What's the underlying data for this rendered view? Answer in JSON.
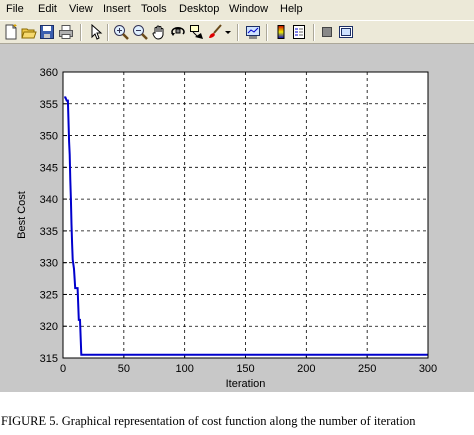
{
  "menubar": {
    "items": [
      {
        "label": "File"
      },
      {
        "label": "Edit"
      },
      {
        "label": "View"
      },
      {
        "label": "Insert"
      },
      {
        "label": "Tools"
      },
      {
        "label": "Desktop"
      },
      {
        "label": "Window"
      },
      {
        "label": "Help"
      }
    ]
  },
  "toolbar": {
    "icons": [
      "new-figure-icon",
      "open-file-icon",
      "save-icon",
      "print-icon",
      "edit-plot-pointer-icon",
      "zoom-in-icon",
      "zoom-out-icon",
      "pan-hand-icon",
      "rotate-3d-icon",
      "data-cursor-icon",
      "brush-icon",
      "brush-dropdown-icon",
      "link-plot-icon",
      "insert-colorbar-icon",
      "insert-legend-icon",
      "hide-plot-tools-icon",
      "show-plot-tools-icon"
    ]
  },
  "colors": {
    "line": "#0000cc",
    "axes_background": "#ffffff",
    "figure_background": "#c8c8c8"
  },
  "chart_data": {
    "type": "line",
    "title": "",
    "xlabel": "Iteration",
    "ylabel": "Best Cost",
    "xlim": [
      0,
      300
    ],
    "ylim": [
      315,
      360
    ],
    "x_ticks": [
      0,
      50,
      100,
      150,
      200,
      250,
      300
    ],
    "y_ticks": [
      315,
      320,
      325,
      330,
      335,
      340,
      345,
      350,
      355,
      360
    ],
    "grid": true,
    "series": [
      {
        "x": [
          1,
          2,
          3,
          4,
          5,
          5.5,
          6,
          6.5,
          7,
          7.5,
          8,
          9,
          10,
          11,
          12,
          13,
          14,
          15,
          300
        ],
        "y": [
          356,
          356,
          355.5,
          355.5,
          349,
          347,
          343,
          340,
          336,
          333,
          330.5,
          329,
          326,
          326,
          326,
          321,
          321,
          315.5,
          315.5
        ]
      }
    ]
  },
  "caption": "FIGURE 5. Graphical representation of cost function along the number of iteration"
}
